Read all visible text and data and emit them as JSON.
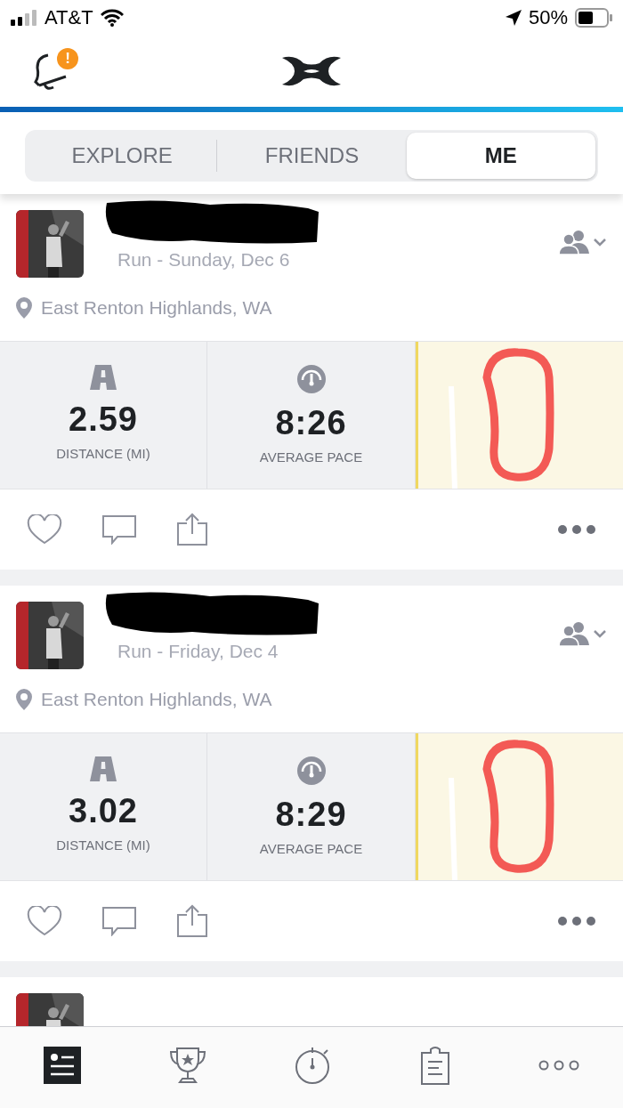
{
  "status_bar": {
    "carrier": "AT&T",
    "battery": "50%"
  },
  "header": {
    "notification_badge": "!"
  },
  "tabs": [
    {
      "label": "EXPLORE",
      "selected": false
    },
    {
      "label": "FRIENDS",
      "selected": false
    },
    {
      "label": "ME",
      "selected": true
    }
  ],
  "posts": [
    {
      "subtitle": "Run - Sunday, Dec 6",
      "location": "East Renton Highlands, WA",
      "stats": [
        {
          "kind": "distance",
          "value": "2.59",
          "label": "DISTANCE (MI)"
        },
        {
          "kind": "pace",
          "value": "8:26",
          "label": "AVERAGE PACE"
        }
      ]
    },
    {
      "subtitle": "Run - Friday, Dec 4",
      "location": "East Renton Highlands, WA",
      "stats": [
        {
          "kind": "distance",
          "value": "3.02",
          "label": "DISTANCE (MI)"
        },
        {
          "kind": "pace",
          "value": "8:29",
          "label": "AVERAGE PACE"
        }
      ]
    }
  ],
  "bottom_nav": [
    {
      "kind": "feed",
      "selected": true
    },
    {
      "kind": "challenges",
      "selected": false
    },
    {
      "kind": "record",
      "selected": false
    },
    {
      "kind": "plans",
      "selected": false
    },
    {
      "kind": "more",
      "selected": false
    }
  ]
}
